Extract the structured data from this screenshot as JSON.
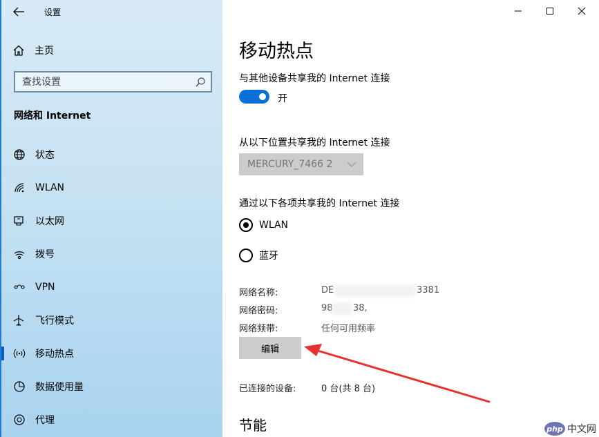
{
  "app": {
    "title": "设置"
  },
  "sidebar": {
    "home_label": "主页",
    "search_placeholder": "查找设置",
    "section_title": "网络和 Internet",
    "items": [
      {
        "label": "状态",
        "icon": "globe-icon"
      },
      {
        "label": "WLAN",
        "icon": "wifi-icon"
      },
      {
        "label": "以太网",
        "icon": "ethernet-icon"
      },
      {
        "label": "拨号",
        "icon": "dialup-icon"
      },
      {
        "label": "VPN",
        "icon": "vpn-icon"
      },
      {
        "label": "飞行模式",
        "icon": "airplane-icon"
      },
      {
        "label": "移动热点",
        "icon": "hotspot-icon",
        "active": true
      },
      {
        "label": "数据使用量",
        "icon": "data-usage-icon"
      },
      {
        "label": "代理",
        "icon": "proxy-icon"
      }
    ]
  },
  "main": {
    "title": "移动热点",
    "share_label": "与其他设备共享我的 Internet 连接",
    "toggle_state": "开",
    "toggle_on": true,
    "share_from_label": "从以下位置共享我的 Internet 连接",
    "share_from_value": "MERCURY_7466 2",
    "share_over_label": "通过以下各项共享我的 Internet 连接",
    "radio_options": [
      {
        "label": "WLAN",
        "selected": true
      },
      {
        "label": "蓝牙",
        "selected": false
      }
    ],
    "network_name_label": "网络名称:",
    "network_name_prefix": "DE",
    "network_name_suffix": "3381",
    "network_password_label": "网络密码:",
    "network_password_prefix": "98",
    "network_password_suffix": "38,",
    "network_band_label": "网络频带:",
    "network_band_value": "任何可用频率",
    "edit_button": "编辑",
    "connected_label": "已连接的设备:",
    "connected_value": "0 台(共 8 台)",
    "power_section_title": "节能"
  },
  "colors": {
    "accent": "#0a6fd6",
    "annotation_arrow": "#e8312f"
  },
  "watermark": {
    "logo": "php",
    "text": "中文网"
  }
}
